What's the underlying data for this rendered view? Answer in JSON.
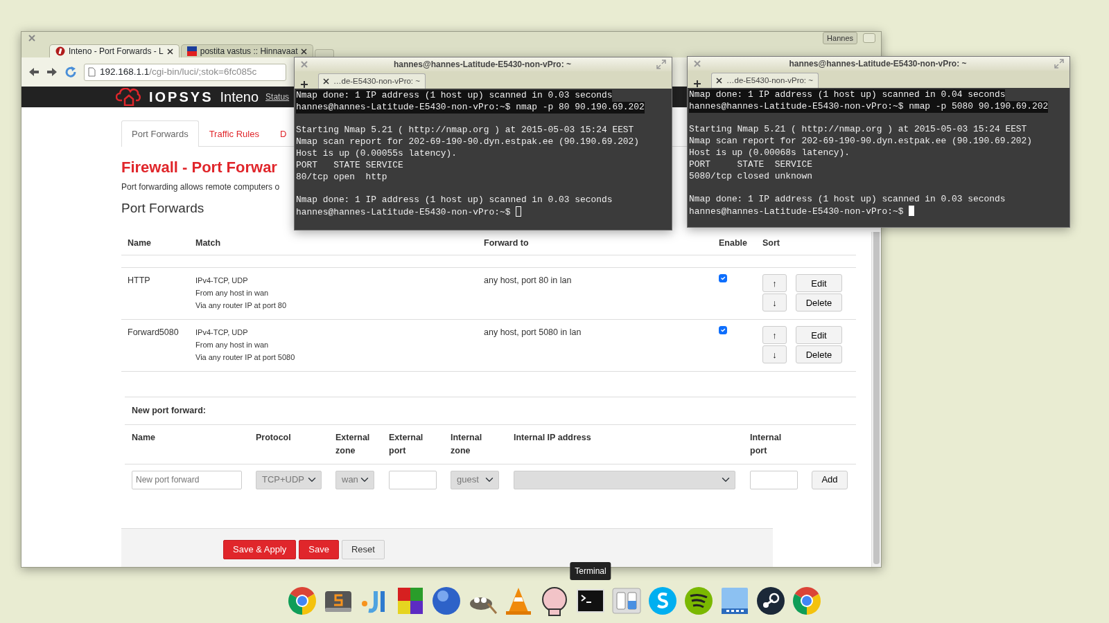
{
  "desktop": {
    "browser": {
      "title_bar": {
        "user_badge": "Hannes"
      },
      "tabs": [
        {
          "title": "Inteno - Port Forwards - L",
          "selected": true
        },
        {
          "title": "postita vastus :: Hinnavaat",
          "selected": false
        }
      ],
      "address": {
        "host": "192.168.1.1",
        "path": "/cgi-bin/luci/;stok=6fc085c"
      },
      "site": {
        "brand": "IOPSYS",
        "product": "Inteno",
        "nav": [
          "Status"
        ]
      },
      "page_tabs": [
        {
          "label": "Port Forwards",
          "selected": true
        },
        {
          "label": "Traffic Rules",
          "selected": false
        },
        {
          "label": "D",
          "selected": false
        }
      ],
      "heading": "Firewall - Port Forwar",
      "description": "Port forwarding allows remote computers o",
      "section_title": "Port Forwards",
      "table": {
        "columns": [
          "Name",
          "Match",
          "Forward to",
          "Enable",
          "Sort"
        ],
        "rows": [
          {
            "name": "HTTP",
            "match": [
              "IPv4-TCP, UDP",
              "From any host in wan",
              "Via any router IP at port 80"
            ],
            "forward_to": "any host, port 80 in lan",
            "enabled": true,
            "up": "↑",
            "down": "↓",
            "edit": "Edit",
            "delete": "Delete"
          },
          {
            "name": "Forward5080",
            "match": [
              "IPv4-TCP, UDP",
              "From any host in wan",
              "Via any router IP at port 5080"
            ],
            "forward_to": "any host, port 5080 in lan",
            "enabled": true,
            "up": "↑",
            "down": "↓",
            "edit": "Edit",
            "delete": "Delete"
          }
        ]
      },
      "new_form": {
        "title": "New port forward:",
        "columns": [
          [
            "Name"
          ],
          [
            "Protocol"
          ],
          [
            "External",
            "zone"
          ],
          [
            "External",
            "port"
          ],
          [
            "Internal",
            "zone"
          ],
          [
            "Internal IP address"
          ],
          [
            "Internal",
            "port"
          ]
        ],
        "name_placeholder": "New port forward",
        "protocol": "TCP+UDP",
        "external_zone": "wan",
        "internal_zone": "guest",
        "add": "Add"
      },
      "actions": [
        {
          "label": "Save & Apply",
          "kind": "danger"
        },
        {
          "label": "Save",
          "kind": "danger"
        },
        {
          "label": "Reset",
          "kind": "default"
        }
      ]
    },
    "terminals": [
      {
        "title": "hannes@hannes-Latitude-E5430-non-vPro: ~",
        "tab": "…de-E5430-non-vPro: ~",
        "focused": false,
        "lines": [
          {
            "text": "Nmap done: 1 IP address (1 host up) scanned in 0.03 seconds",
            "highlighted": true
          },
          {
            "text": "hannes@hannes-Latitude-E5430-non-vPro:~$ nmap -p 80 90.190.69.202",
            "highlighted": true
          },
          {
            "text": "Starting Nmap 5.21 ( http://nmap.org ) at 2015-05-03 15:24 EEST",
            "blank_before": true
          },
          {
            "text": "Nmap scan report for 202-69-190-90.dyn.estpak.ee (90.190.69.202)"
          },
          {
            "text": "Host is up (0.00055s latency)."
          },
          {
            "text": "PORT   STATE SERVICE"
          },
          {
            "text": "80/tcp open  http"
          },
          {
            "text": "Nmap done: 1 IP address (1 host up) scanned in 0.03 seconds",
            "blank_before": true
          },
          {
            "text": "hannes@hannes-Latitude-E5430-non-vPro:~$ ",
            "cursor": true
          }
        ]
      },
      {
        "title": "hannes@hannes-Latitude-E5430-non-vPro: ~",
        "tab": "…de-E5430-non-vPro: ~",
        "focused": true,
        "lines": [
          {
            "text": "Nmap done: 1 IP address (1 host up) scanned in 0.04 seconds",
            "highlighted": true
          },
          {
            "text": "hannes@hannes-Latitude-E5430-non-vPro:~$ nmap -p 5080 90.190.69.202",
            "highlighted": true
          },
          {
            "text": "Starting Nmap 5.21 ( http://nmap.org ) at 2015-05-03 15:24 EEST",
            "blank_before": true
          },
          {
            "text": "Nmap scan report for 202-69-190-90.dyn.estpak.ee (90.190.69.202)"
          },
          {
            "text": "Host is up (0.00068s latency)."
          },
          {
            "text": "PORT     STATE  SERVICE"
          },
          {
            "text": "5080/tcp closed unknown"
          },
          {
            "text": "Nmap done: 1 IP address (1 host up) scanned in 0.03 seconds",
            "blank_before": true
          },
          {
            "text": "hannes@hannes-Latitude-E5430-non-vPro:~$ ",
            "cursor": true
          }
        ]
      }
    ],
    "dock": {
      "items": [
        {
          "kind": "wheel"
        },
        {
          "kind": "tile"
        },
        {
          "kind": "bars"
        },
        {
          "kind": "blocks"
        },
        {
          "kind": "ball"
        },
        {
          "kind": "animal"
        },
        {
          "kind": "cone"
        },
        {
          "kind": "pink"
        },
        {
          "kind": "terminal",
          "tooltip": "Terminal"
        },
        {
          "kind": "switcher"
        },
        {
          "kind": "bluecircle"
        },
        {
          "kind": "waves"
        },
        {
          "kind": "screen"
        },
        {
          "kind": "darkcircle"
        },
        {
          "kind": "wheel"
        }
      ]
    }
  }
}
